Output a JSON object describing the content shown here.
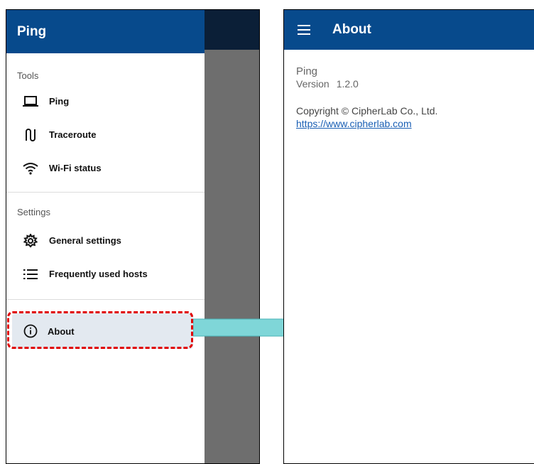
{
  "drawer": {
    "title": "Ping",
    "sections": [
      {
        "label": "Tools",
        "items": [
          {
            "label": "Ping",
            "icon": "laptop-icon"
          },
          {
            "label": "Traceroute",
            "icon": "route-icon"
          },
          {
            "label": "Wi-Fi status",
            "icon": "wifi-icon"
          }
        ]
      },
      {
        "label": "Settings",
        "items": [
          {
            "label": "General settings",
            "icon": "gear-icon"
          },
          {
            "label": "Frequently used hosts",
            "icon": "list-icon"
          }
        ]
      }
    ],
    "selected_item": {
      "label": "About",
      "icon": "info-icon"
    }
  },
  "about_screen": {
    "title": "About",
    "app_name": "Ping",
    "version_label": "Version",
    "version": "1.2.0",
    "copyright": "Copyright © CipherLab Co., Ltd.",
    "link": "https://www.cipherlab.com"
  },
  "colors": {
    "appbar": "#074a8c",
    "highlight": "#e00000",
    "arrow": "#7fd6d8",
    "selected_bg": "#e3e9f0"
  }
}
